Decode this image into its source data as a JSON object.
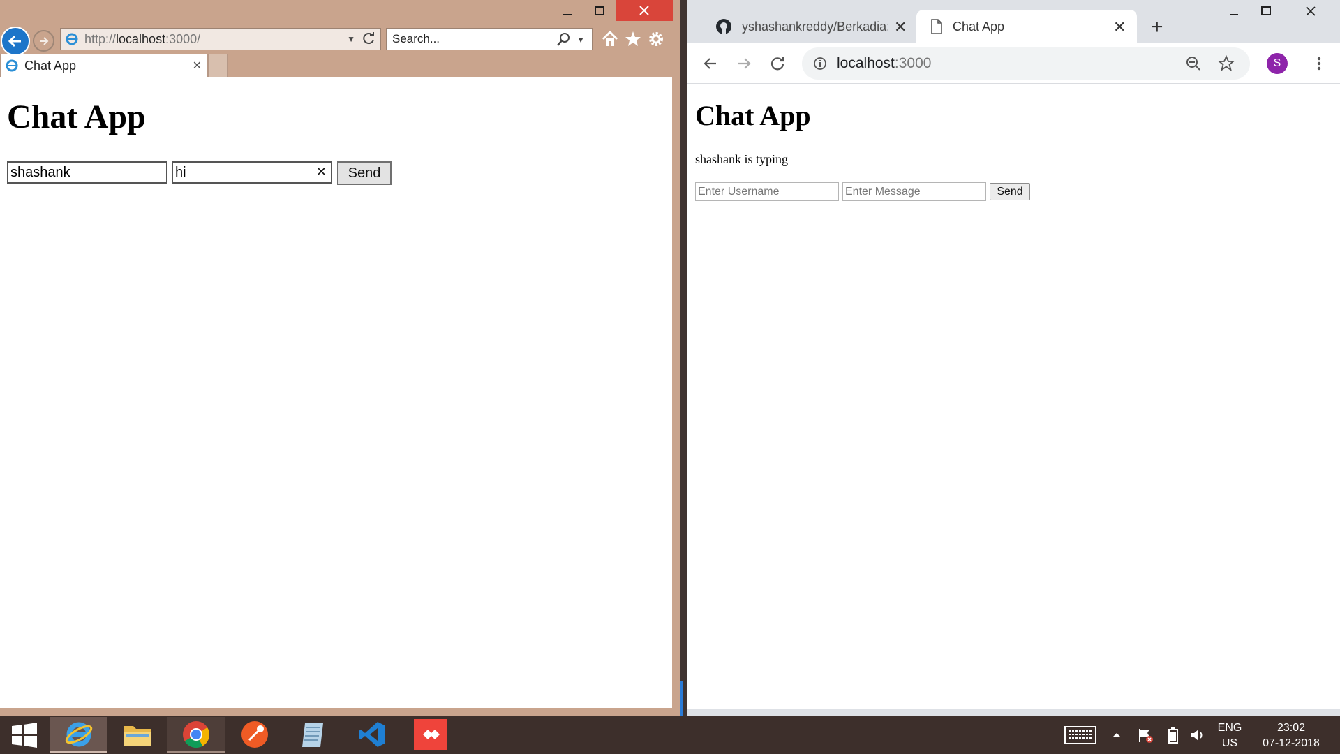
{
  "ie": {
    "address_prefix": "http://",
    "address_host": "localhost",
    "address_rest": ":3000/",
    "search_placeholder": "Search...",
    "tab_title": "Chat App",
    "page": {
      "heading": "Chat App",
      "username_value": "shashank",
      "message_value": "hi",
      "send_label": "Send"
    }
  },
  "chrome": {
    "tab1_title": "yshashankreddy/Berkadia: E",
    "tab2_title": "Chat App",
    "address_host": "localhost",
    "address_rest": ":3000",
    "avatar_letter": "S",
    "avatar_color": "#8e24aa",
    "page": {
      "heading": "Chat App",
      "typing_status": "shashank is typing",
      "username_placeholder": "Enter Username",
      "message_placeholder": "Enter Message",
      "send_label": "Send"
    }
  },
  "taskbar": {
    "language": "ENG",
    "region": "US",
    "time": "23:02",
    "date": "07-12-2018",
    "apps": [
      "internet-explorer",
      "file-explorer",
      "chrome",
      "postman",
      "notepad",
      "vscode",
      "anydesk"
    ]
  }
}
